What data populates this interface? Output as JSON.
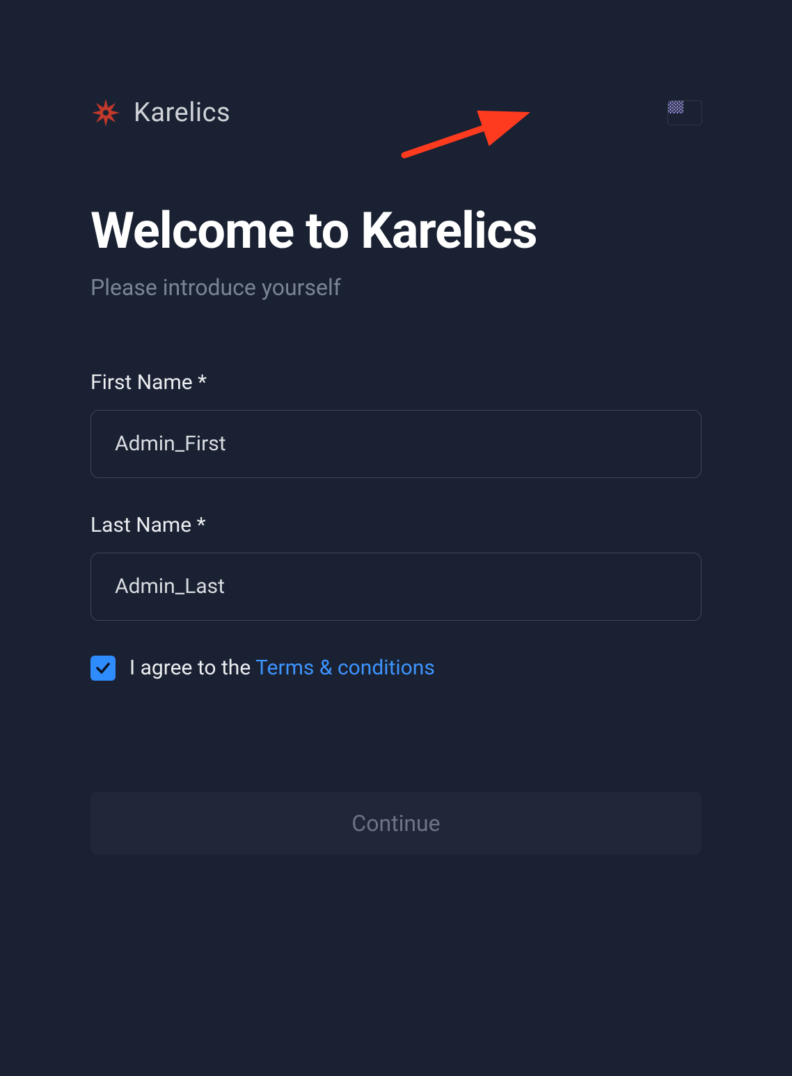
{
  "brand": {
    "name": "Karelics"
  },
  "lang_flag": "us",
  "heading": {
    "title": "Welcome to Karelics",
    "subtitle": "Please introduce yourself"
  },
  "form": {
    "first_name": {
      "label": "First Name *",
      "value": "Admin_First"
    },
    "last_name": {
      "label": "Last Name *",
      "value": "Admin_Last"
    },
    "consent": {
      "checked": true,
      "prefix": "I agree to the ",
      "link_text": "Terms & conditions"
    }
  },
  "actions": {
    "continue_label": "Continue"
  },
  "annotation": {
    "arrow_color": "#ff3b1f"
  }
}
